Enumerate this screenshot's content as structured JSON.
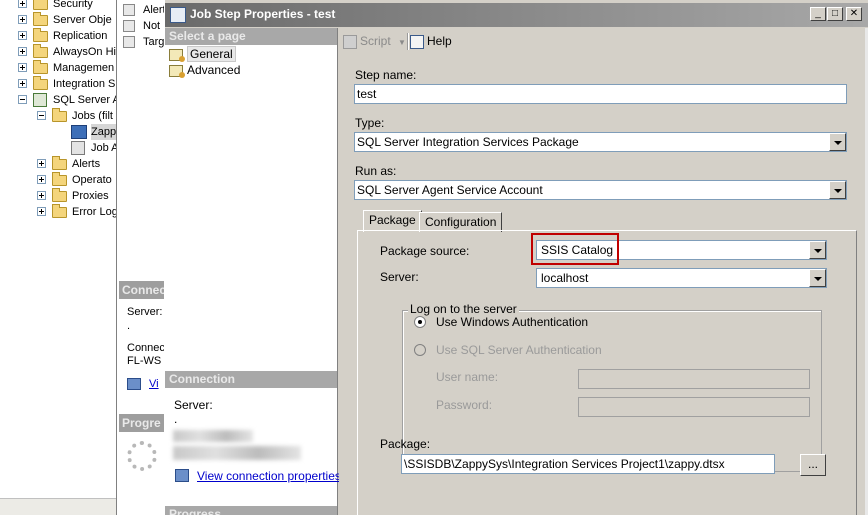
{
  "explorer": {
    "items": [
      {
        "label": "Security",
        "type": "folder",
        "expander": "plus"
      },
      {
        "label": "Server Obje",
        "type": "folder",
        "expander": "plus"
      },
      {
        "label": "Replication",
        "type": "folder",
        "expander": "plus"
      },
      {
        "label": "AlwaysOn Hi",
        "type": "folder",
        "expander": "plus"
      },
      {
        "label": "Managemen",
        "type": "folder",
        "expander": "plus"
      },
      {
        "label": "Integration S",
        "type": "folder",
        "expander": "plus"
      },
      {
        "label": "SQL Server A",
        "type": "agent",
        "expander": "minus"
      },
      {
        "label": "Jobs (filt",
        "type": "folder",
        "expander": "minus"
      },
      {
        "label": "Zapp",
        "type": "job",
        "expander": ""
      },
      {
        "label": "Job Activ",
        "type": "activity",
        "expander": ""
      },
      {
        "label": "Alerts",
        "type": "folder",
        "expander": "plus"
      },
      {
        "label": "Operato",
        "type": "folder",
        "expander": "plus"
      },
      {
        "label": "Proxies",
        "type": "folder",
        "expander": "plus"
      },
      {
        "label": "Error Log",
        "type": "folder",
        "expander": "plus"
      }
    ]
  },
  "bg_window": {
    "list_items": [
      "Alert",
      "Not",
      "Targ"
    ],
    "connection_header": "Connec",
    "server_label": "Server:",
    "server_value": ".",
    "connection_label": "Connec",
    "connection_value": "FL-WS",
    "view_link": "Vi",
    "progress_header": "Progre"
  },
  "dialog": {
    "title": "Job Step Properties - test",
    "pages_header": "Select a page",
    "pages": [
      {
        "label": "General",
        "selected": true
      },
      {
        "label": "Advanced",
        "selected": false
      }
    ],
    "connection_header": "Connection",
    "server_label": "Server:",
    "server_value": ".",
    "view_connection_link": "View connection properties",
    "progress_header": "Progress",
    "toolbar": {
      "script_label": "Script",
      "help_label": "Help"
    },
    "form": {
      "step_name_label": "Step name:",
      "step_name_value": "test",
      "type_label": "Type:",
      "type_value": "SQL Server Integration Services Package",
      "run_as_label": "Run as:",
      "run_as_value": "SQL Server Agent Service Account",
      "tabs": [
        {
          "label": "Package",
          "active": true
        },
        {
          "label": "Configuration",
          "active": false
        }
      ],
      "package_source_label": "Package source:",
      "package_source_value": "SSIS Catalog",
      "server_label": "Server:",
      "server_value": "localhost",
      "logon_group_label": "Log on to the server",
      "windows_auth_label": "Use Windows Authentication",
      "sql_auth_label": "Use SQL Server Authentication",
      "user_name_label": "User name:",
      "password_label": "Password:",
      "package_label": "Package:",
      "package_value": "\\SSISDB\\ZappySys\\Integration Services Project1\\zappy.dtsx",
      "browse_label": "..."
    }
  },
  "colors": {
    "highlight": "#c00000",
    "title_bar": "#6a6a6a",
    "link": "#0000cc"
  }
}
